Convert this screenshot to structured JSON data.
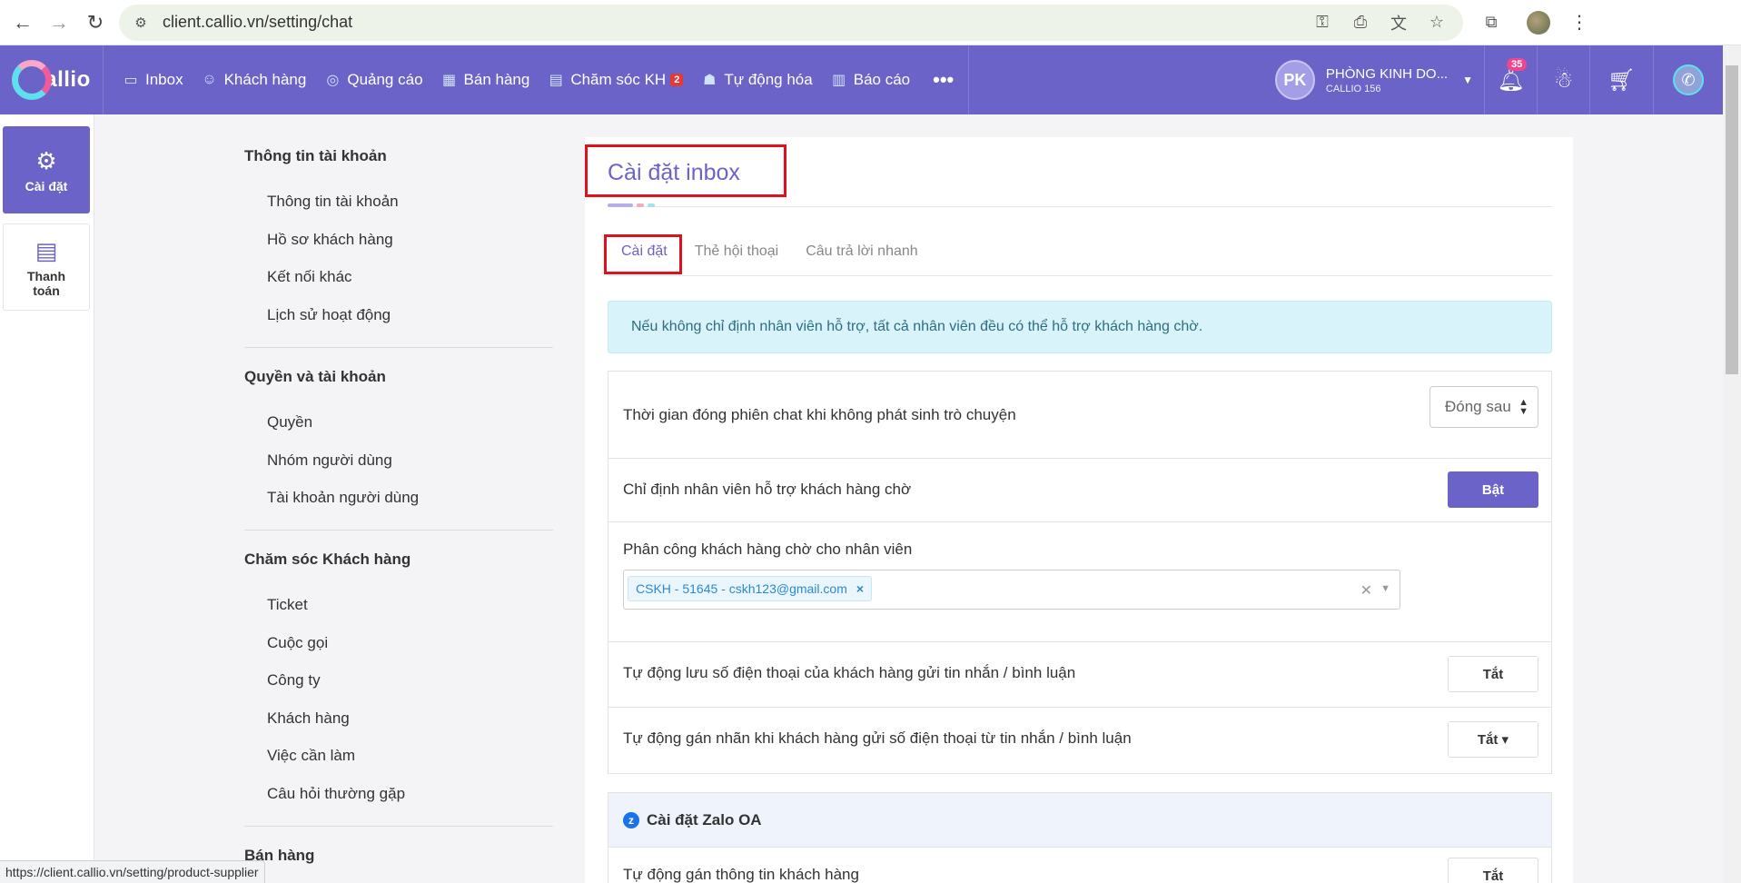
{
  "browser": {
    "url": "client.callio.vn/setting/chat",
    "status_url": "https://client.callio.vn/setting/product-supplier"
  },
  "header": {
    "logo_text": "allio",
    "nav": [
      {
        "label": "Inbox",
        "icon": "inbox-icon"
      },
      {
        "label": "Khách hàng",
        "icon": "customer-icon"
      },
      {
        "label": "Quảng cáo",
        "icon": "ads-icon"
      },
      {
        "label": "Bán hàng",
        "icon": "store-icon"
      },
      {
        "label": "Chăm sóc KH",
        "icon": "care-icon",
        "badge": "2"
      },
      {
        "label": "Tự động hóa",
        "icon": "robot-icon"
      },
      {
        "label": "Báo cáo",
        "icon": "report-icon"
      }
    ],
    "more": "•••",
    "account": {
      "initials": "PK",
      "name": "PHÒNG KINH DO...",
      "sub": "CALLIO 156"
    },
    "notification_count": "35"
  },
  "rail": {
    "items": [
      {
        "label": "Cài đặt",
        "icon": "gear-icon"
      },
      {
        "label": "Thanh toán",
        "icon": "invoice-icon"
      }
    ]
  },
  "menu": {
    "sections": [
      {
        "title": "Thông tin tài khoản",
        "links": [
          "Thông tin tài khoản",
          "Hồ sơ khách hàng",
          "Kết nối khác",
          "Lịch sử hoạt động"
        ]
      },
      {
        "title": "Quyền và tài khoản",
        "links": [
          "Quyền",
          "Nhóm người dùng",
          "Tài khoản người dùng"
        ]
      },
      {
        "title": "Chăm sóc Khách hàng",
        "links": [
          "Ticket",
          "Cuộc gọi",
          "Công ty",
          "Khách hàng",
          "Việc cần làm",
          "Câu hỏi thường gặp"
        ]
      },
      {
        "title": "Bán hàng",
        "links": []
      }
    ]
  },
  "main": {
    "title": "Cài đặt inbox",
    "tabs": [
      "Cài đặt",
      "Thẻ hội thoại",
      "Câu trả lời nhanh"
    ],
    "alert": "Nếu không chỉ định nhân viên hỗ trợ, tất cả nhân viên đều có thể hỗ trợ khách hàng chờ.",
    "settings": {
      "close_session_label": "Thời gian đóng phiên chat khi không phát sinh trò chuyện",
      "close_session_value": "Đóng sau",
      "assign_label": "Chỉ định nhân viên hỗ trợ khách hàng chờ",
      "assign_button": "Bật",
      "assign_staff_label": "Phân công khách hàng chờ cho nhân viên",
      "assigned_chip": "CSKH - 51645 - cskh123@gmail.com",
      "auto_save_phone_label": "Tự động lưu số điện thoại của khách hàng gửi tin nhắn / bình luận",
      "auto_save_phone_button": "Tắt",
      "auto_label_label": "Tự động gán nhãn khi khách hàng gửi số điện thoại từ tin nhắn / bình luận",
      "auto_label_button": "Tắt ▾"
    },
    "zalo": {
      "title": "Cài đặt Zalo OA",
      "auto_assign_label": "Tự động gán thông tin khách hàng",
      "auto_assign_button": "Tắt"
    }
  },
  "colors": {
    "brand": "#6c63c9",
    "highlight_box": "#e0101c",
    "alert_bg": "#d8f3f9"
  }
}
